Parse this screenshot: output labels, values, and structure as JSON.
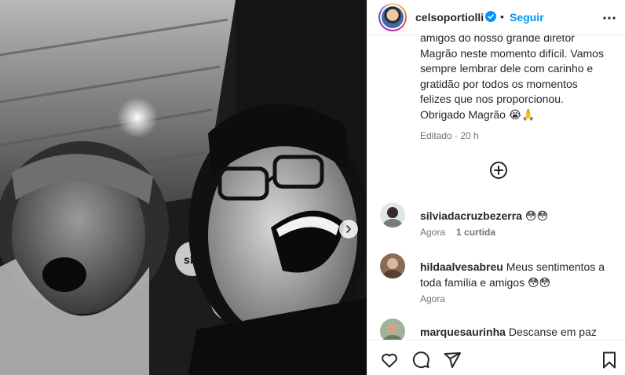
{
  "post": {
    "username": "celsoportiolli",
    "verified": true,
    "separator": "•",
    "follow_label": "Seguir",
    "more_icon": "more-horizontal-icon",
    "caption_lines": [
      "amigos do nosso grande diretor",
      "Magrão neste momento difícil. Vamos",
      "sempre lembrar dele com carinho e",
      "gratidão por todos os momentos",
      "felizes que nos proporcionou.",
      "Obrigado Magrão 😭🙏"
    ],
    "caption_meta": "Editado · 20 h",
    "load_more_icon": "plus-circle-icon"
  },
  "comments": [
    {
      "username": "silviadacruzbezerra",
      "text": "😳😳",
      "time": "Agora",
      "likes": "1 curtida",
      "reply": ""
    },
    {
      "username": "hildaalvesabreu",
      "text": "Meus sentimentos a toda família e amigos 😳😳",
      "time": "Agora",
      "likes": "",
      "reply": ""
    },
    {
      "username": "marquesaurinha",
      "text": "Descanse em paz 🙌",
      "time": "",
      "likes": "",
      "reply": ""
    }
  ],
  "media": {
    "next_icon": "chevron-right-icon",
    "sign_text": "sbt"
  },
  "actions": {
    "like_icon": "heart-icon",
    "comment_icon": "comment-icon",
    "share_icon": "send-icon",
    "save_icon": "bookmark-icon"
  },
  "colors": {
    "accent": "#0095f6",
    "text": "#262626",
    "secondary": "#737373",
    "border": "#efefef",
    "verified": "#0095f6"
  }
}
